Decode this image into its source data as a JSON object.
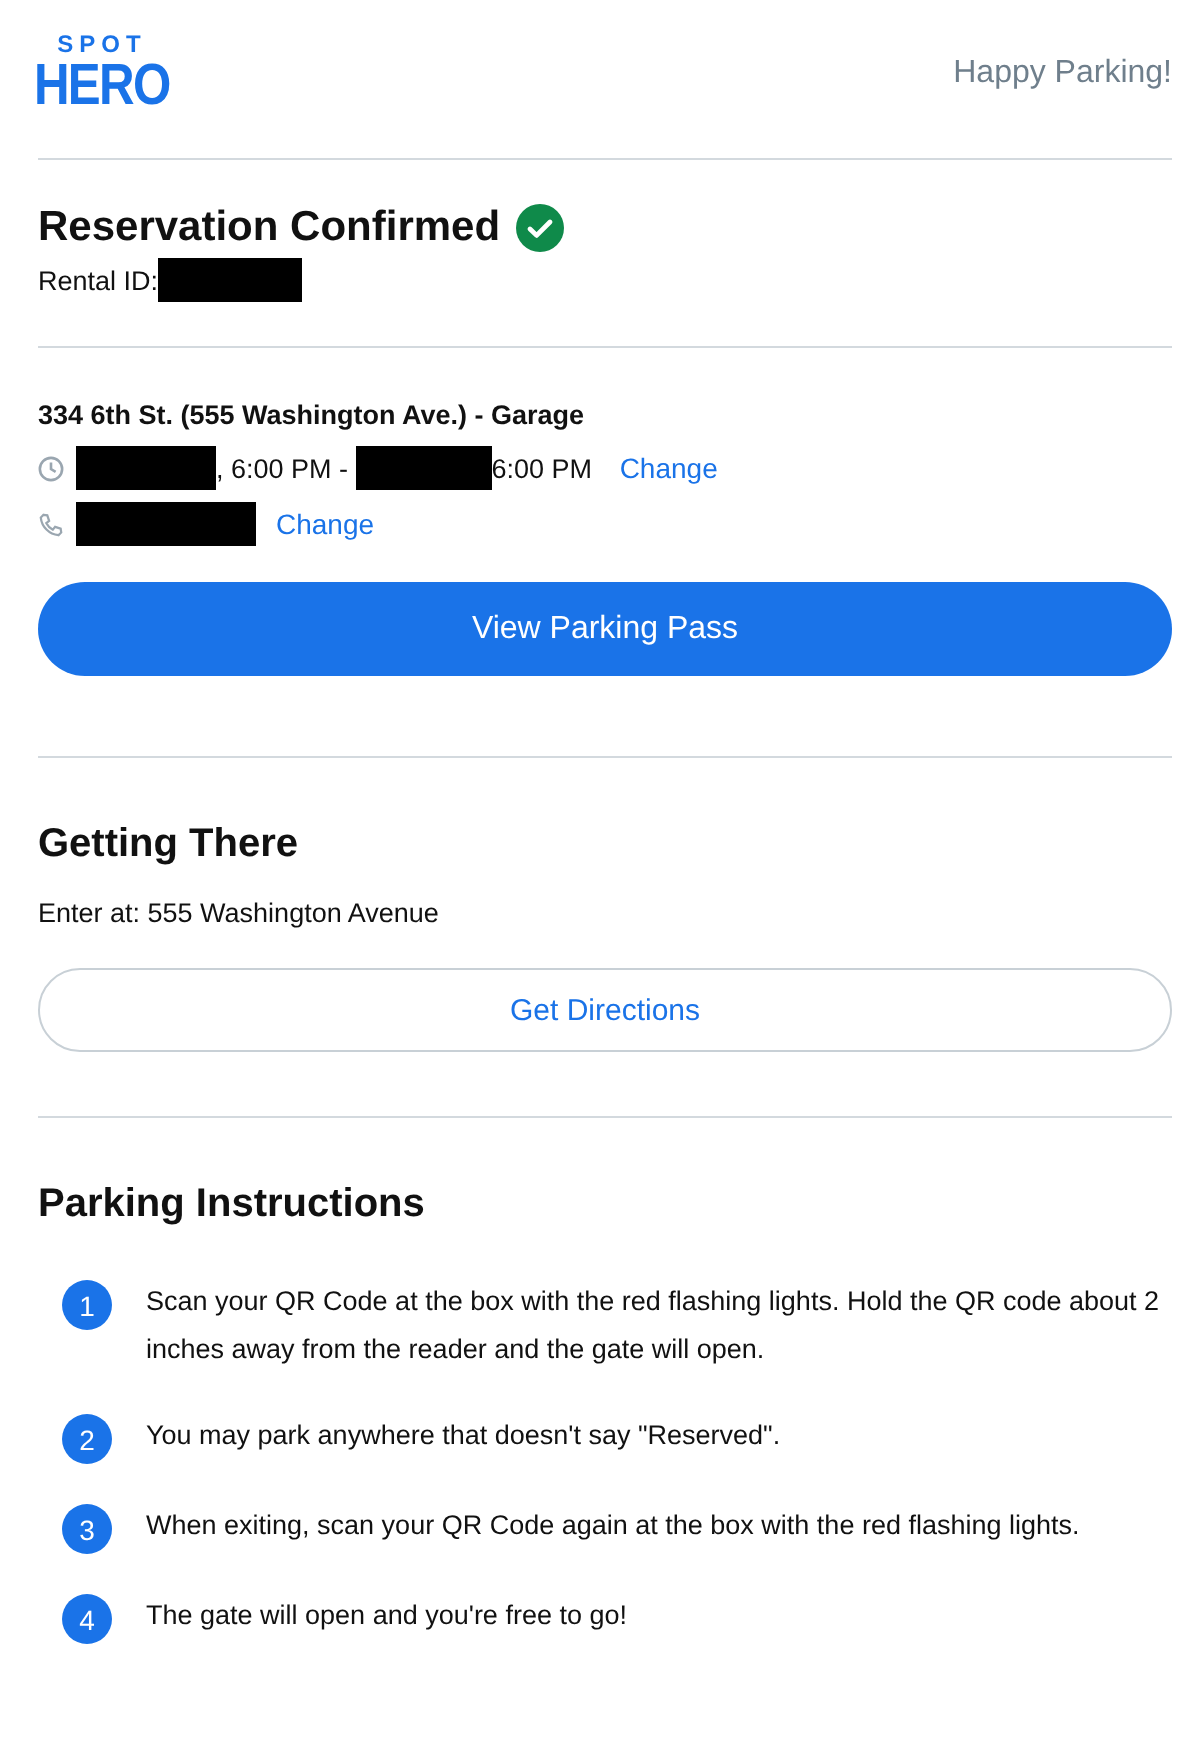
{
  "header": {
    "logo_top": "SPOT",
    "logo_bottom": "HERO",
    "tagline": "Happy Parking!"
  },
  "confirmation": {
    "title": "Reservation Confirmed",
    "confirmed": true,
    "rental_label": "Rental ID:",
    "rental_id": [
      {
        "kind": "redacted"
      }
    ]
  },
  "reservation": {
    "address": "334 6th St. (555 Washington Ave.) - Garage",
    "time": [
      {
        "kind": "redacted"
      },
      {
        "kind": "text",
        "text": ", 6:00 PM -"
      },
      {
        "kind": "redacted"
      },
      {
        "kind": "text",
        "text": "6:00 PM"
      }
    ],
    "time_action": "Change",
    "phone": [
      {
        "kind": "redacted"
      }
    ],
    "phone_action": "Change",
    "pass_button": "View Parking Pass"
  },
  "getting_there": {
    "title": "Getting There",
    "entry": "Enter at: 555 Washington Avenue",
    "directions_button": "Get Directions"
  },
  "instructions": {
    "title": "Parking Instructions",
    "steps": [
      {
        "number": "1",
        "text": "Scan your QR Code at the box with the red flashing lights. Hold the QR code about 2 inches away from the reader and the gate will open."
      },
      {
        "number": "2",
        "text": "You may park anywhere that doesn't say \"Reserved\"."
      },
      {
        "number": "3",
        "text": "When exiting, scan your QR Code again at the box with the red flashing lights."
      },
      {
        "number": "4",
        "text": "The gate will open and you're free to go!"
      }
    ]
  }
}
